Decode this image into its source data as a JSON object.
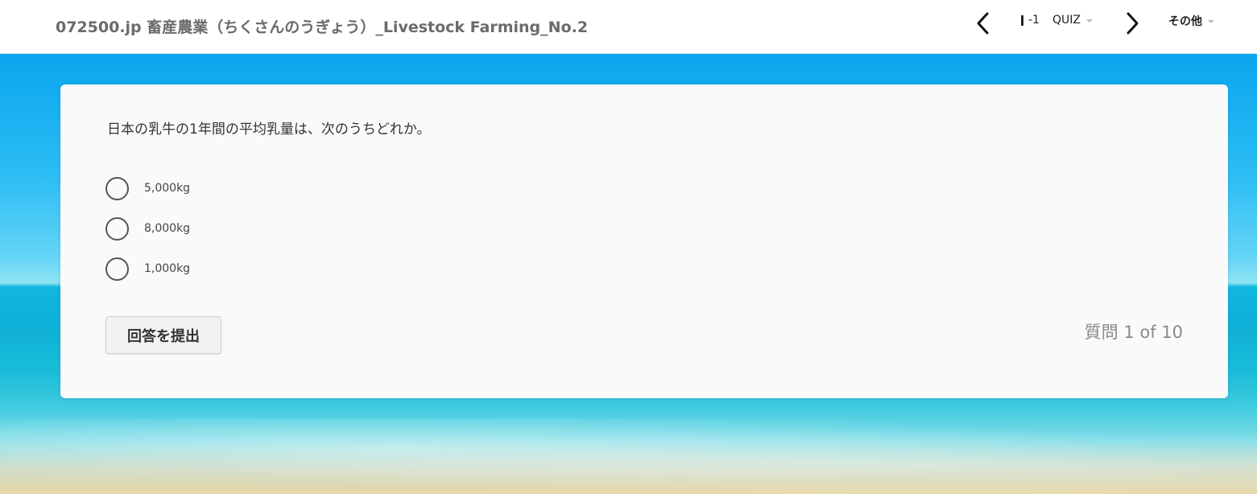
{
  "header": {
    "course_title": "072500.jp 畜産農業（ちくさんのうぎょう）_Livestock Farming_No.2",
    "lesson_number": "-1",
    "lesson_type": "QUIZ",
    "more_menu_label": "その他"
  },
  "quiz": {
    "question": "日本の乳牛の1年間の平均乳量は、次のうちどれか。",
    "options": [
      {
        "label": "5,000kg",
        "selected": false
      },
      {
        "label": "8,000kg",
        "selected": false
      },
      {
        "label": "1,000kg",
        "selected": false
      }
    ],
    "submit_label": "回答を提出",
    "counter": "質問 1 of 10"
  },
  "colors": {
    "card_background": "#fafafa",
    "title_text": "#6b6b6b",
    "sky_top": "#0aa6ee",
    "sea": "#10b6e0",
    "sand": "#e6d8a8"
  },
  "icons": {
    "prev": "chevron-left-icon",
    "next": "chevron-right-icon",
    "dropdown": "caret-down-icon",
    "radio": "radio-unchecked-icon"
  }
}
